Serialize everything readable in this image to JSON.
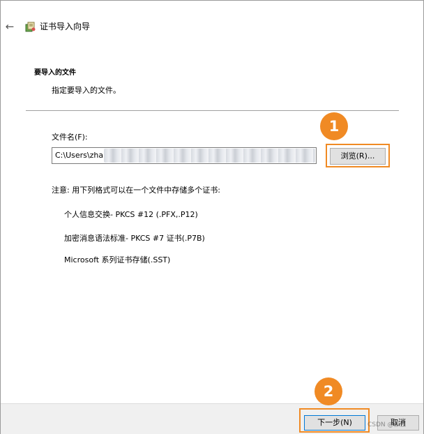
{
  "window": {
    "title": "证书导入向导"
  },
  "icons": {
    "back": "back-arrow-icon",
    "wizard": "certificate-wizard-icon"
  },
  "header": {
    "section_title": "要导入的文件",
    "section_desc": "指定要导入的文件。"
  },
  "file": {
    "label": "文件名(F):",
    "value": "C:\\Users\\zha",
    "browse_label": "浏览(R)..."
  },
  "note": {
    "text": "注意: 用下列格式可以在一个文件中存储多个证书:",
    "formats": [
      "个人信息交换- PKCS #12 (.PFX,.P12)",
      "加密消息语法标准- PKCS #7 证书(.P7B)",
      "Microsoft 系列证书存储(.SST)"
    ]
  },
  "footer": {
    "next_label": "下一步(N)",
    "cancel_label": "取消"
  },
  "annotations": {
    "badge_1": "1",
    "badge_2": "2",
    "highlight_color": "#f08a24"
  },
  "watermark": "CSDN @张三"
}
